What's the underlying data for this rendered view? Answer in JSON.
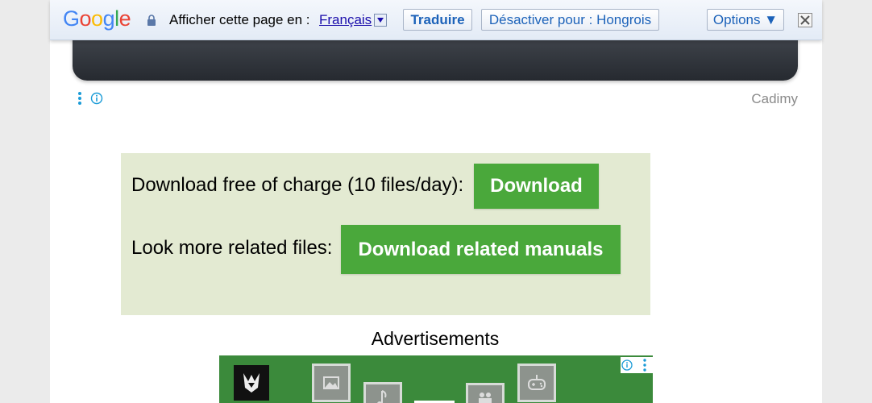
{
  "translate_bar": {
    "logo_text": "Google",
    "prompt": "Afficher cette page en :",
    "language": "Français",
    "translate_label": "Traduire",
    "disable_label": "Désactiver pour : Hongrois",
    "options_label": "Options ▼"
  },
  "header": {
    "brand": "Cadimy"
  },
  "download_box": {
    "free_text": "Download free of charge (10 files/day):",
    "download_label": "Download",
    "related_text": "Look more related files:",
    "related_label": "Download related manuals"
  },
  "ads": {
    "heading": "Advertisements"
  },
  "colors": {
    "accent_green": "#4aa83b",
    "box_background": "#e3ead2",
    "link_blue": "#1a0dab",
    "bar_button_text": "#1c62b9"
  }
}
